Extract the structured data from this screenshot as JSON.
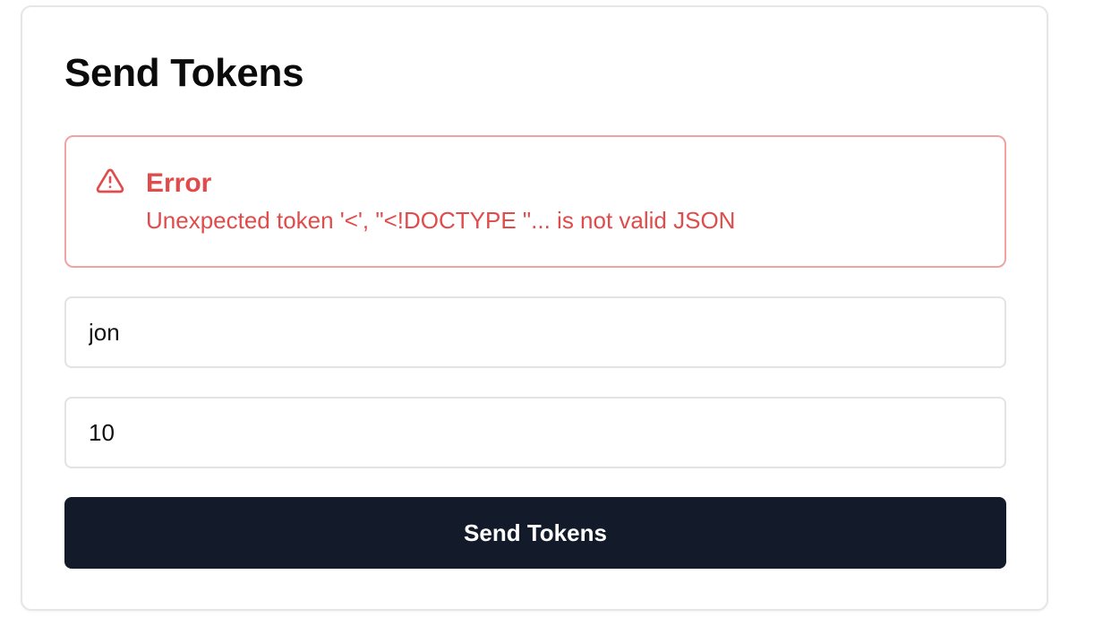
{
  "page": {
    "title": "Send Tokens"
  },
  "alert": {
    "icon": "warning-triangle-icon",
    "title": "Error",
    "message": "Unexpected token '<', \"<!DOCTYPE \"... is not valid JSON",
    "color": "#e04b4b",
    "border_color": "#f1a3a3"
  },
  "form": {
    "recipient_value": "jon",
    "amount_value": "10",
    "submit_label": "Send Tokens",
    "submit_color": "#131a2a"
  }
}
